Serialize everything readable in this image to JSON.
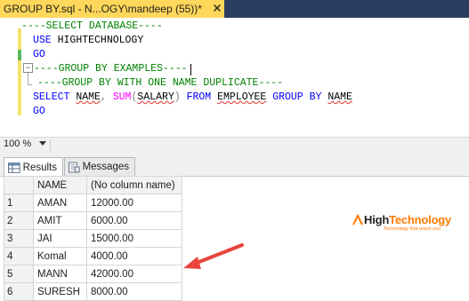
{
  "document_tab": {
    "title": "GROUP BY.sql - N...OGY\\mandeep (55))*",
    "close_icon": "close-icon",
    "tab_color": "#ffd75a"
  },
  "editor": {
    "lines": [
      {
        "parts": [
          {
            "text": "----SELECT DATABASE----",
            "cls": "cmt"
          }
        ]
      },
      {
        "parts": [
          {
            "text": "USE ",
            "cls": "kw"
          },
          {
            "text": "HIGHTECHNOLOGY",
            "cls": "ident"
          }
        ]
      },
      {
        "parts": [
          {
            "text": "GO",
            "cls": "kw"
          }
        ]
      },
      {
        "parts": [
          {
            "text": "----GROUP BY EXAMPLES----",
            "cls": "cmt"
          }
        ]
      },
      {
        "parts": [
          {
            "text": "----GROUP BY WITH ONE NAME DUPLICATE----",
            "cls": "cmt"
          }
        ]
      },
      {
        "parts": [
          {
            "text": "SELECT ",
            "cls": "kw"
          },
          {
            "text": "NAME",
            "cls": "ident squig"
          },
          {
            "text": ", ",
            "cls": "gray"
          },
          {
            "text": "SUM",
            "cls": "fn"
          },
          {
            "text": "(",
            "cls": "gray"
          },
          {
            "text": "SALARY",
            "cls": "ident squig"
          },
          {
            "text": ") ",
            "cls": "gray"
          },
          {
            "text": "FROM ",
            "cls": "kw"
          },
          {
            "text": "EMPLOYEE",
            "cls": "ident squig"
          },
          {
            "text": " GROUP BY ",
            "cls": "kw"
          },
          {
            "text": "NAME",
            "cls": "ident squig"
          }
        ]
      },
      {
        "parts": [
          {
            "text": "GO",
            "cls": "kw"
          }
        ]
      }
    ],
    "fold_symbol": "−"
  },
  "zoom": {
    "value": "100 %"
  },
  "result_tabs": [
    {
      "label": "Results",
      "icon": "results-grid-icon",
      "active": true
    },
    {
      "label": "Messages",
      "icon": "messages-icon",
      "active": false
    }
  ],
  "grid": {
    "columns": [
      "NAME",
      "(No column name)"
    ],
    "rows": [
      [
        "1",
        "AMAN",
        "12000.00"
      ],
      [
        "2",
        "AMIT",
        "6000.00"
      ],
      [
        "3",
        "JAI",
        "15000.00"
      ],
      [
        "4",
        "Komal",
        "4000.00"
      ],
      [
        "5",
        "MANN",
        "42000.00"
      ],
      [
        "6",
        "SURESH",
        "8000.00"
      ]
    ]
  },
  "logo": {
    "prefix": "High",
    "suffix": "Technology",
    "tagline": "Technology that teach you",
    "accent": "#ff7a00"
  },
  "annotation_arrow_color": "#e8453c"
}
